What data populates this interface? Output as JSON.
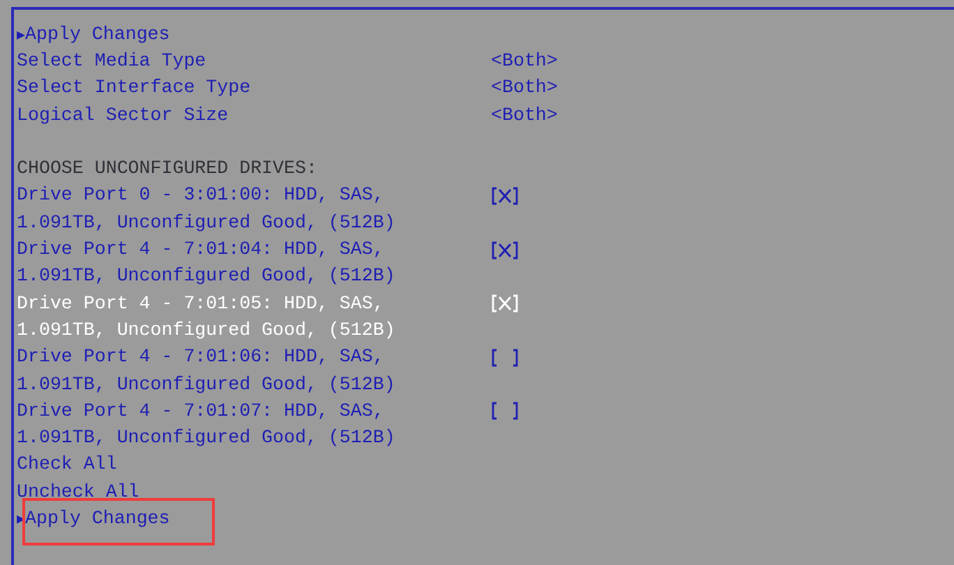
{
  "menu_top": {
    "arrow": "▶",
    "label": "Apply Changes"
  },
  "settings": [
    {
      "label": "Select Media Type",
      "value": "<Both>"
    },
    {
      "label": "Select Interface Type",
      "value": "<Both>"
    },
    {
      "label": "Logical Sector Size",
      "value": "<Both>"
    }
  ],
  "section_heading": "CHOOSE UNCONFIGURED DRIVES:",
  "drives": [
    {
      "line1": "Drive Port 0 - 3:01:00: HDD, SAS,",
      "line2": "1.091TB, Unconfigured Good, (512B)",
      "checked": true,
      "selected": false
    },
    {
      "line1": "Drive Port 4 - 7:01:04: HDD, SAS,",
      "line2": "1.091TB, Unconfigured Good, (512B)",
      "checked": true,
      "selected": false
    },
    {
      "line1": "Drive Port 4 - 7:01:05: HDD, SAS,",
      "line2": "1.091TB, Unconfigured Good, (512B)",
      "checked": true,
      "selected": true
    },
    {
      "line1": "Drive Port 4 - 7:01:06: HDD, SAS,",
      "line2": "1.091TB, Unconfigured Good, (512B)",
      "checked": false,
      "selected": false
    },
    {
      "line1": "Drive Port 4 - 7:01:07: HDD, SAS,",
      "line2": "1.091TB, Unconfigured Good, (512B)",
      "checked": false,
      "selected": false
    }
  ],
  "actions": [
    {
      "label": "Check All"
    },
    {
      "label": "Uncheck All"
    }
  ],
  "apply": {
    "arrow": "▶",
    "label": "Apply Changes",
    "highlighted": true
  }
}
